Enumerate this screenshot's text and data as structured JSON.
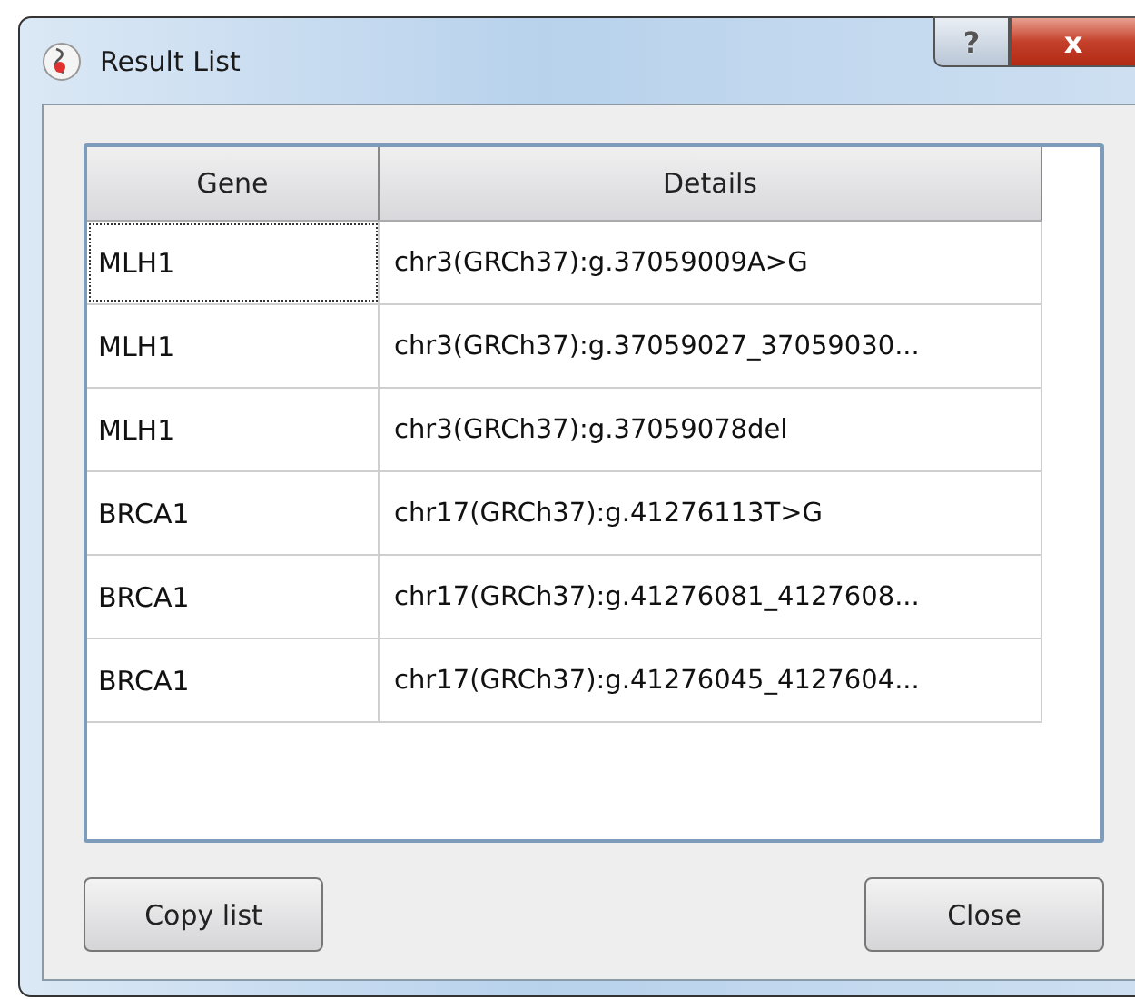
{
  "window": {
    "title": "Result List",
    "help_button": "?",
    "close_button": "x"
  },
  "table": {
    "columns": [
      "Gene",
      "Details"
    ],
    "rows": [
      {
        "gene": "MLH1",
        "details": "chr3(GRCh37):g.37059009A>G",
        "focused": true
      },
      {
        "gene": "MLH1",
        "details": "chr3(GRCh37):g.37059027_37059030...",
        "focused": false
      },
      {
        "gene": "MLH1",
        "details": "chr3(GRCh37):g.37059078del",
        "focused": false
      },
      {
        "gene": "BRCA1",
        "details": "chr17(GRCh37):g.41276113T>G",
        "focused": false
      },
      {
        "gene": "BRCA1",
        "details": "chr17(GRCh37):g.41276081_4127608...",
        "focused": false
      },
      {
        "gene": "BRCA1",
        "details": "chr17(GRCh37):g.41276045_4127604...",
        "focused": false
      }
    ]
  },
  "buttons": [
    "Copy list",
    "Close"
  ]
}
